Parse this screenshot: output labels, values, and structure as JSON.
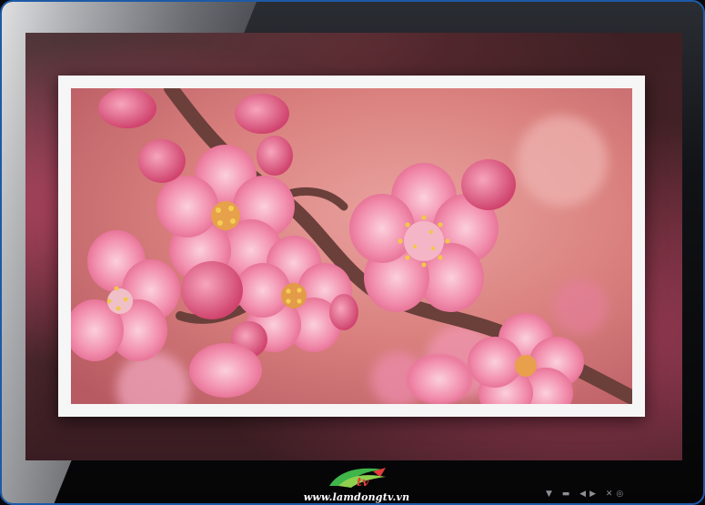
{
  "branding": {
    "logo_icon": "lamdong-tv-logo",
    "url": "www.lamdongtv.vn"
  },
  "tv": {
    "frame_color": "#1c5aa6",
    "controls_label": "▼ ▬ ◀▶ ✕◎"
  },
  "photo": {
    "subject": "pink plum blossoms",
    "accent_color": "#e8557a"
  }
}
